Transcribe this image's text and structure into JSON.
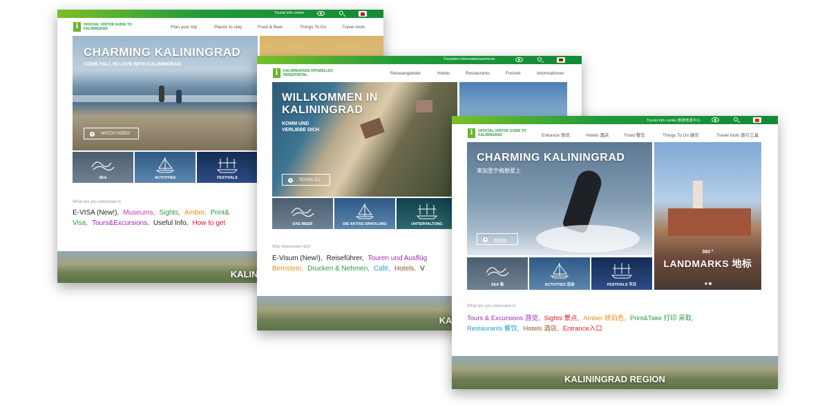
{
  "colors": {
    "green": "#2b9a3a",
    "pink": "#d12ea8",
    "orange": "#f08a1c",
    "purple": "#9b2bb0",
    "red": "#e0162b",
    "blue": "#1e9ad6",
    "brown": "#8a5a2b",
    "black": "#222222"
  },
  "windows": [
    {
      "topbar": {
        "info": "Tourist info center"
      },
      "logo": {
        "line1": "OFFICIAL VISITOR GUIDE TO",
        "line2": "KALININGRAD"
      },
      "nav": [
        "Plan your trip",
        "Places to stay",
        "Food & Beer",
        "Things To Do",
        "Travel tools"
      ],
      "hero": {
        "title": "CHARMING KALININGRAD",
        "subtitle": "COME FALL IN LOVE WITH KALININGRAD",
        "watch": "WATCH VIDEO"
      },
      "tiles": [
        "SEA",
        "ACTIVITIES",
        "FESTIVALS"
      ],
      "interest_heading": "What are you interested in",
      "interests": [
        [
          {
            "t": "E-VISA (New!),",
            "c": "black"
          },
          {
            "t": "Museums,",
            "c": "pink"
          },
          {
            "t": "Sights,",
            "c": "green"
          },
          {
            "t": "Amber,",
            "c": "orange"
          },
          {
            "t": "Print&",
            "c": "green"
          }
        ],
        [
          {
            "t": "Visa,",
            "c": "green"
          },
          {
            "t": "Tours&Excursions,",
            "c": "purple"
          },
          {
            "t": "Useful Info,",
            "c": "black"
          },
          {
            "t": "How to get",
            "c": "red"
          }
        ]
      ],
      "region": "KALININGRAD REGI"
    },
    {
      "topbar": {
        "info": "Touristen-Informationszentrum"
      },
      "logo": {
        "line1": "KALININGRADS OFFIZIELLES",
        "line2": "REISEPORTAL"
      },
      "nav": [
        "Reiseangebote",
        "Hotels",
        "Restaurants",
        "Freizeit",
        "Informationen"
      ],
      "hero": {
        "title1": "WILLKOMMEN IN",
        "title2": "KALININGRAD",
        "sub1": "KOMM UND",
        "sub2": "VERLIEBE DICH",
        "watch": "SCHAU ZU"
      },
      "tiles": [
        "DAS MEER",
        "DIE AKTIVE ERHOLUNG",
        "UNTERHALTUNG"
      ],
      "interest_heading": "Was interessiert dich",
      "interests": [
        [
          {
            "t": "E-Visum (New!),",
            "c": "black"
          },
          {
            "t": "Reiseführer,",
            "c": "black"
          },
          {
            "t": "Touren und Ausflüg",
            "c": "purple"
          }
        ],
        [
          {
            "t": "Bernstein,",
            "c": "orange"
          },
          {
            "t": "Drucken & Nehmen,",
            "c": "green"
          },
          {
            "t": "Café,",
            "c": "blue"
          },
          {
            "t": "Hotels,",
            "c": "brown"
          },
          {
            "t": "V",
            "c": "black"
          }
        ]
      ],
      "region": "KALININGRADER G"
    },
    {
      "topbar": {
        "info": "Tourist info center 旅游信息中心"
      },
      "logo": {
        "line1": "OFFICIAL VISITOR GUIDE TO",
        "line2": "KALININGRAD"
      },
      "nav": [
        "Entrance 快讯",
        "Hotels 酒店",
        "Food 餐饮",
        "Things To Do 娱乐",
        "Travel tools 旅行工具"
      ],
      "hero": {
        "title": "CHARMING KALININGRAD",
        "subtitle": "来加里宁格勒爱上",
        "watch": "看视频"
      },
      "side": {
        "degree": "360 °",
        "title": "LANDMARKS 地标"
      },
      "tiles": [
        "SEA 海",
        "ACTIVITIES 活动",
        "FESTIVALS 节日"
      ],
      "interest_heading": "What are you interested in",
      "interests": [
        [
          {
            "t": "Tours & Excursions 游览,",
            "c": "purple"
          },
          {
            "t": "Sights 景点,",
            "c": "red"
          },
          {
            "t": "Amber 琥珀色,",
            "c": "orange"
          },
          {
            "t": "Print&Take 打印 采取,",
            "c": "green"
          }
        ],
        [
          {
            "t": "Restaurants 餐饮,",
            "c": "blue"
          },
          {
            "t": "Hotels 酒店,",
            "c": "brown"
          },
          {
            "t": "Entrance入口",
            "c": "red"
          }
        ]
      ],
      "region": "KALININGRAD REGION"
    }
  ]
}
